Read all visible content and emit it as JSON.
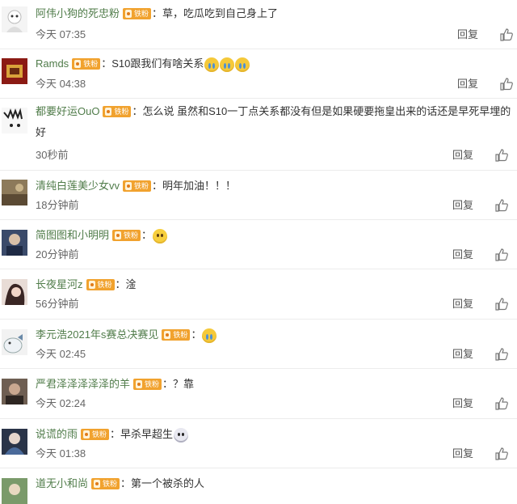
{
  "labels": {
    "reply": "回复"
  },
  "comments": [
    {
      "user": "阿伟小狗的死忠粉",
      "badge": "铁粉",
      "colon": "：",
      "text": "草，吃瓜吃到自己身上了",
      "emojis": [],
      "time": "今天 07:35"
    },
    {
      "user": "Ramds",
      "badge": "铁粉",
      "colon": "：",
      "text": "S10跟我们有啥关系",
      "emojis": [
        "laugh-cry",
        "laugh-cry",
        "laugh-cry"
      ],
      "time": "今天 04:38"
    },
    {
      "user": "都要好运OuO",
      "badge": "铁粉",
      "colon": "：",
      "text": "怎么说 虽然和S10一丁点关系都没有但是如果硬要拖皇出来的话还是早死早埋的好",
      "emojis": [],
      "time": "30秒前"
    },
    {
      "user": "清纯白莲美少女vv",
      "badge": "铁粉",
      "colon": "：",
      "text": "明年加油！！！",
      "emojis": [],
      "time": "18分钟前"
    },
    {
      "user": "简图图和小明明",
      "badge": "铁粉",
      "colon": "：",
      "text": "",
      "emojis": [
        "pleading"
      ],
      "time": "20分钟前"
    },
    {
      "user": "长夜星河z",
      "badge": "铁粉",
      "colon": "：",
      "text": "淦",
      "emojis": [],
      "time": "56分钟前"
    },
    {
      "user": "李元浩2021年s赛总决赛见",
      "badge": "铁粉",
      "colon": "：",
      "text": "",
      "emojis": [
        "crying"
      ],
      "time": "今天 02:45"
    },
    {
      "user": "严君泽泽泽泽泽的羊",
      "badge": "铁粉",
      "colon": "：",
      "text": "？靠",
      "emojis": [],
      "time": "今天 02:24"
    },
    {
      "user": "说谎的雨",
      "badge": "铁粉",
      "colon": "：",
      "text": "早杀早超生",
      "emojis": [
        "scared"
      ],
      "time": "今天 01:38"
    },
    {
      "user": "道无小和尚",
      "badge": "铁粉",
      "colon": "：",
      "text": "第一个被杀的人",
      "emojis": [],
      "time": ""
    }
  ],
  "colors": {
    "username": "#507c4a",
    "badge": "#f1a22e",
    "divider": "#ececec",
    "text": "#333333",
    "muted": "#666666"
  }
}
